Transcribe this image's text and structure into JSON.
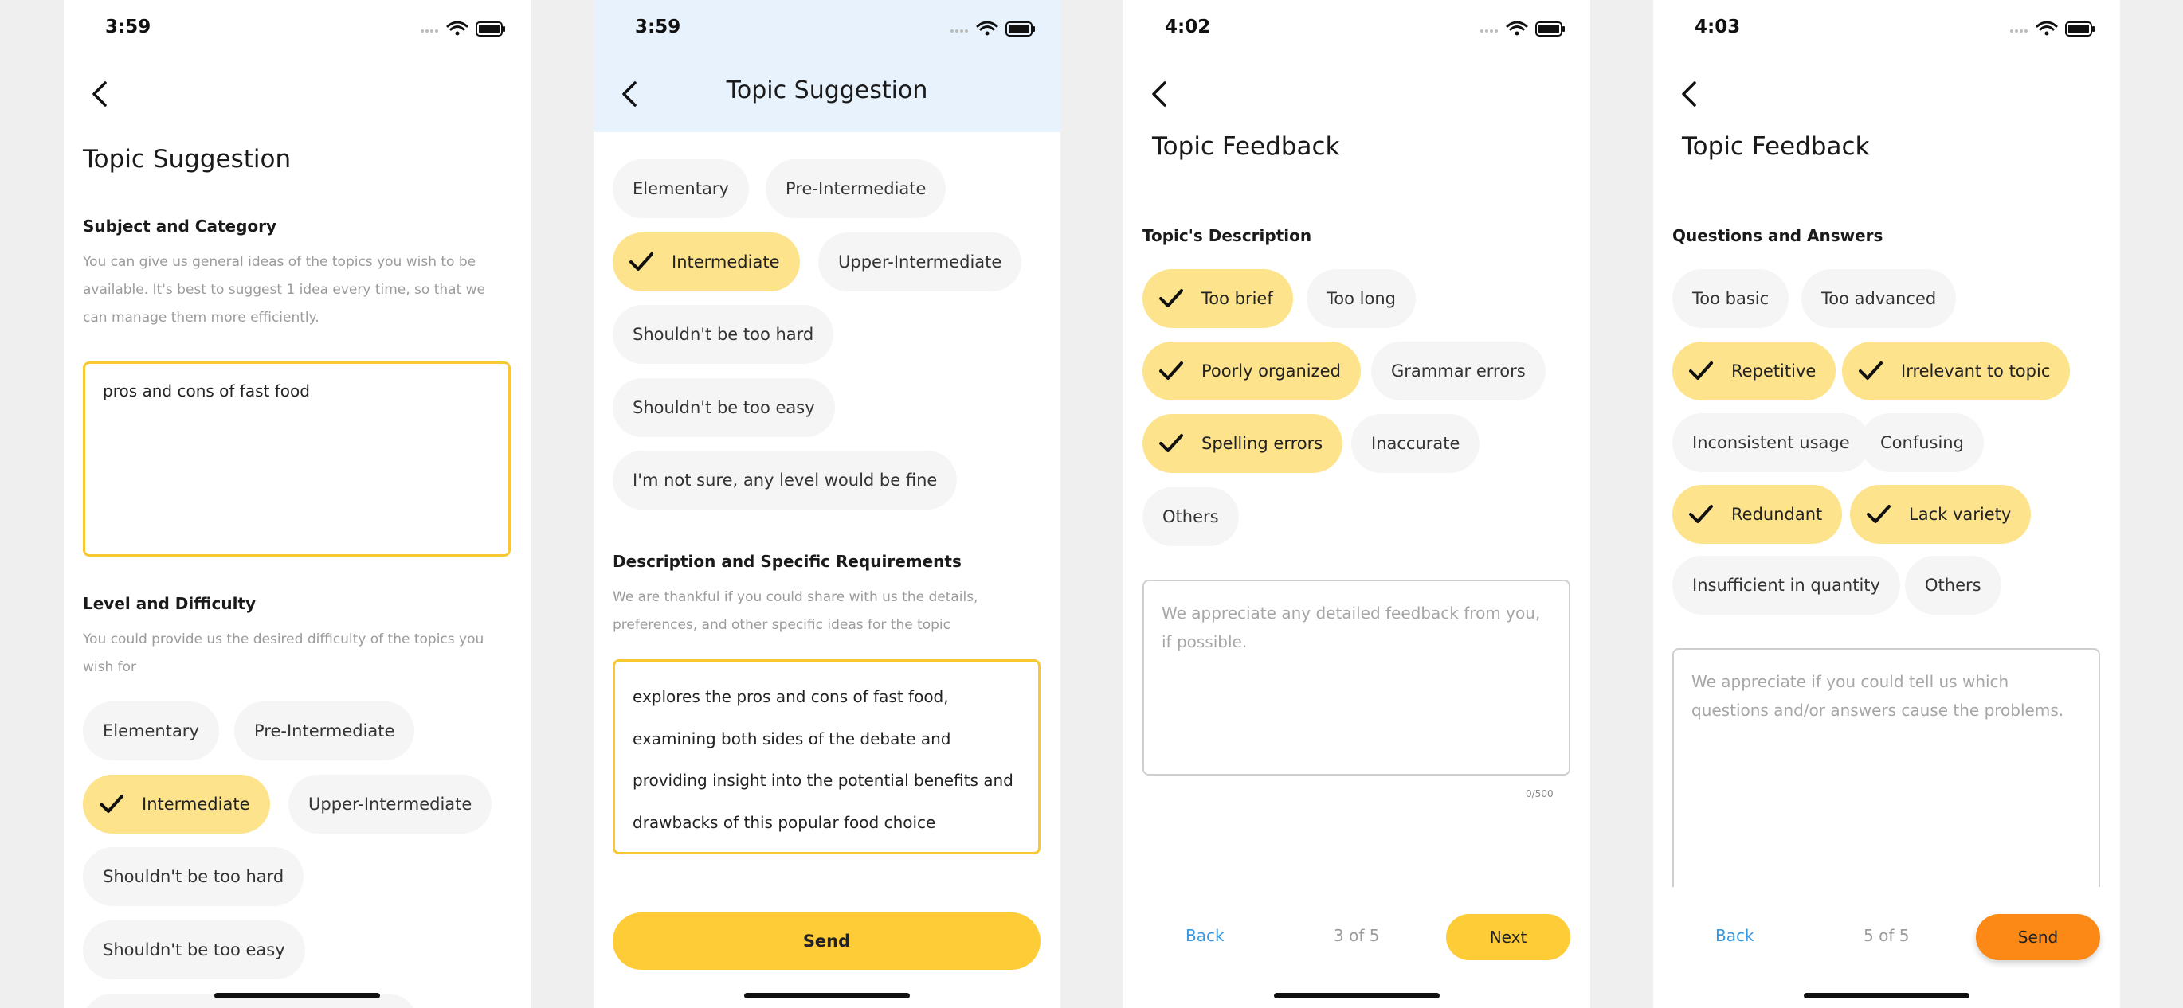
{
  "colors": {
    "accent_yellow": "#fecc36",
    "selected_chip": "#fde38c",
    "chip_bg": "#f5f5f5",
    "send_orange": "#fc8815",
    "link_blue": "#3598e0",
    "header_tint": "#e8f2fd"
  },
  "icons": [
    "back-chevron-icon",
    "cellular-signal-icon",
    "wifi-icon",
    "battery-icon",
    "checkmark-icon"
  ],
  "screen1": {
    "time": "3:59",
    "title": "Topic Suggestion",
    "subject_heading": "Subject and Category",
    "subject_helper": "You can give us general ideas of the topics you wish to be available. It's best to suggest 1 idea every time, so that we can manage them more efficiently.",
    "subject_value": "pros and cons of fast food",
    "level_heading": "Level and Difficulty",
    "level_helper": "You could provide us the desired difficulty of the topics you wish for",
    "options": [
      "Elementary",
      "Pre-Intermediate",
      "Intermediate",
      "Upper-Intermediate",
      "Shouldn't be too hard",
      "Shouldn't be too easy"
    ],
    "selected": [
      "Intermediate"
    ]
  },
  "screen2": {
    "time": "3:59",
    "title": "Topic Suggestion",
    "options": [
      "Elementary",
      "Pre-Intermediate",
      "Intermediate",
      "Upper-Intermediate",
      "Shouldn't be too hard",
      "Shouldn't be too easy",
      "I'm not sure, any level would be fine"
    ],
    "selected": [
      "Intermediate"
    ],
    "desc_heading": "Description and Specific Requirements",
    "desc_helper": "We are thankful if you could share with us the details, preferences, and other specific ideas for the topic",
    "desc_value": "explores the pros and cons of fast food, examining both sides of the debate and providing insight into the potential benefits and drawbacks of this popular food choice",
    "send_label": "Send"
  },
  "screen3": {
    "time": "4:02",
    "title": "Topic Feedback",
    "section_heading": "Topic's Description",
    "options": [
      "Too brief",
      "Too long",
      "Poorly organized",
      "Grammar errors",
      "Spelling errors",
      "Inaccurate",
      "Others"
    ],
    "selected": [
      "Too brief",
      "Poorly organized",
      "Spelling errors"
    ],
    "feedback_placeholder": "We appreciate any detailed feedback from you, if possible.",
    "char_counter": "0/500",
    "back_label": "Back",
    "pager": "3 of 5",
    "next_label": "Next"
  },
  "screen4": {
    "time": "4:03",
    "title": "Topic Feedback",
    "section_heading": "Questions and Answers",
    "options": [
      "Too basic",
      "Too advanced",
      "Repetitive",
      "Irrelevant to topic",
      "Inconsistent usage",
      "Confusing",
      "Redundant",
      "Lack variety",
      "Insufficient in quantity",
      "Others"
    ],
    "selected": [
      "Repetitive",
      "Irrelevant to topic",
      "Redundant",
      "Lack variety"
    ],
    "feedback_placeholder": "We appreciate if you could tell us which questions and/or answers cause the problems.",
    "back_label": "Back",
    "pager": "5 of 5",
    "send_label": "Send"
  }
}
